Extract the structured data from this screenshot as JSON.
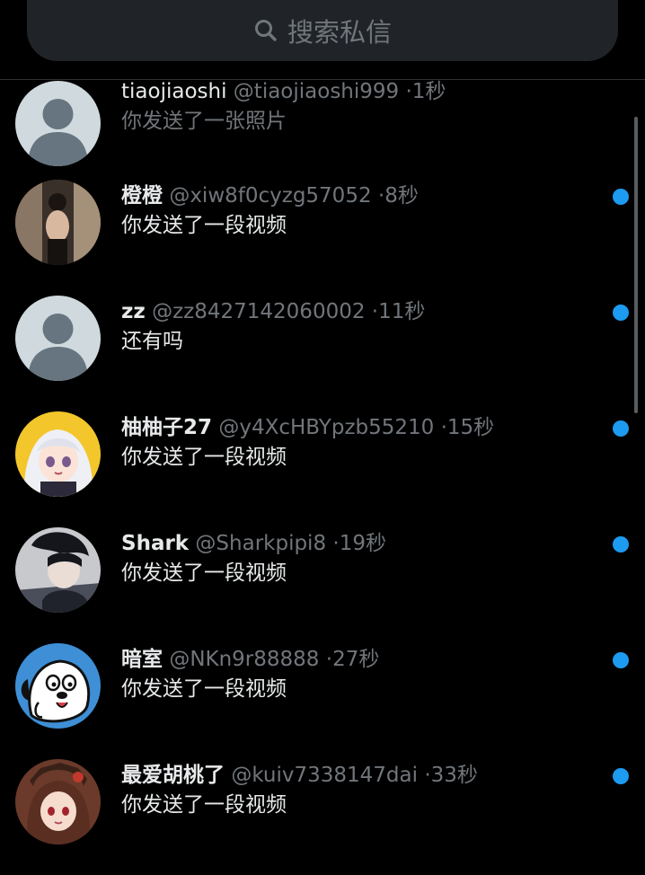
{
  "search": {
    "placeholder": "搜索私信",
    "icon": "search-icon"
  },
  "conversations": [
    {
      "name": "tiaojiaoshi",
      "handle": "@tiaojiaoshi999",
      "separator": "·",
      "time": "1秒",
      "preview": "你发送了一张照片",
      "unread": false,
      "avatar": "default-avatar"
    },
    {
      "name": "橙橙",
      "handle": "@xiw8f0cyzg57052",
      "separator": "·",
      "time": "8秒",
      "preview": "你发送了一段视频",
      "unread": true,
      "avatar": "photo-avatar"
    },
    {
      "name": "zz",
      "handle": "@zz8427142060002",
      "separator": "·",
      "time": "11秒",
      "preview": "还有吗",
      "unread": true,
      "avatar": "default-avatar"
    },
    {
      "name": "柚柚子27",
      "handle": "@y4XcHBYpzb55210",
      "separator": "·",
      "time": "15秒",
      "preview": "你发送了一段视频",
      "unread": true,
      "avatar": "anime-girl-avatar"
    },
    {
      "name": "Shark",
      "handle": "@Sharkpipi8",
      "separator": "·",
      "time": "19秒",
      "preview": "你发送了一段视频",
      "unread": true,
      "avatar": "anime-boy-avatar"
    },
    {
      "name": "暗室",
      "handle": "@NKn9r88888",
      "separator": "·",
      "time": "27秒",
      "preview": "你发送了一段视频",
      "unread": true,
      "avatar": "cartoon-dog-avatar"
    },
    {
      "name": "最爱胡桃了",
      "handle": "@kuiv7338147dai",
      "separator": "·",
      "time": "33秒",
      "preview": "你发送了一段视频",
      "unread": true,
      "avatar": "anime-character-avatar"
    }
  ],
  "colors": {
    "background": "#000000",
    "search_bg": "#202327",
    "primary_text": "#e7e9ea",
    "secondary_text": "#71767b",
    "unread_dot": "#1d9bf0"
  }
}
